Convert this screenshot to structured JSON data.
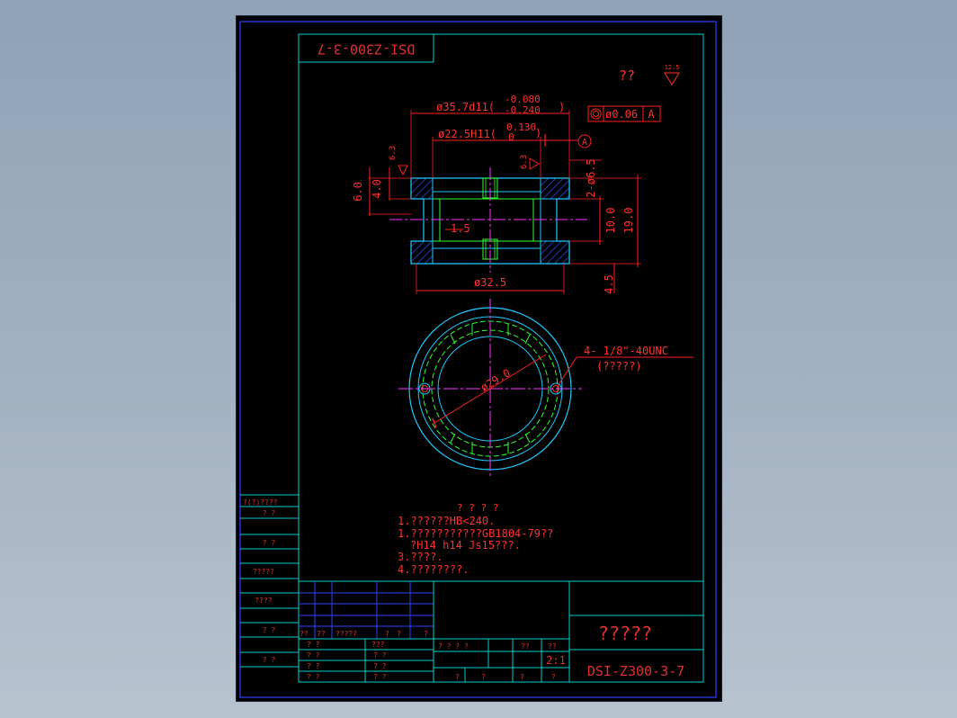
{
  "colors": {
    "background": "#000000",
    "frame": "#3040ff",
    "border": "#00d0d0",
    "dimension": "#ff2020",
    "hidden": "#30ff30",
    "center": "#ff30ff",
    "part": "#20c8ff",
    "text": "#ff3030",
    "title_text": "#e03030",
    "hatch": "#3050ff"
  },
  "drawing": {
    "number_top": "DSI-Z300-3-7",
    "roughness_note": "??",
    "roughness_value": "12.5",
    "dims": {
      "outer_dia": "ø35.7d11(",
      "outer_tol_upper": "-0.080",
      "outer_tol_lower": "-0.240",
      "outer_close": ")",
      "inner_dia": "ø22.5H11(",
      "inner_tol_upper": "0.130",
      "inner_tol_lower": "0",
      "inner_close": ")",
      "concentricity": "ø0.06",
      "datum": "A",
      "datum_circle": "A",
      "rough_left": "6.3",
      "rough_mid": "6.3",
      "holes": "2-ø6.5",
      "h_6": "6.0",
      "h_4": "4.0",
      "gap": "1.5",
      "h_10": "10.0",
      "h_19": "19.0",
      "h_45": "4.5",
      "bottom_dia": "ø32.5",
      "pcd": "ø29.0",
      "thread": "4-   1/8\"-40UNC",
      "thread_note": "(?????)"
    },
    "notes": {
      "title": "? ? ? ?",
      "lines": [
        "1.??????HB<240.",
        "1.???????????GB1804-79??",
        "?H14  h14  Js15???.",
        "3.????.",
        "4.????????."
      ]
    }
  },
  "left_column": [
    "?(?)????",
    "?  ?",
    "?  ?",
    "?????",
    "????",
    "?  ?",
    "?  ?"
  ],
  "title_block": {
    "part_name": "?????",
    "drawing_number": "DSI-Z300-3-7",
    "scale": "2:1",
    "row_labels": [
      "??",
      "??",
      "?????",
      "?",
      "?",
      "?"
    ],
    "sign_labels": [
      "? ?",
      "? ?",
      "? ?",
      "? ?"
    ],
    "sign_labels2": [
      "???",
      "? ?",
      "? ?",
      "? ?"
    ],
    "mid_labels": [
      "? ? ? ?",
      "??",
      "??"
    ],
    "bottom_labels": [
      "?",
      "?",
      "?",
      "?"
    ]
  }
}
